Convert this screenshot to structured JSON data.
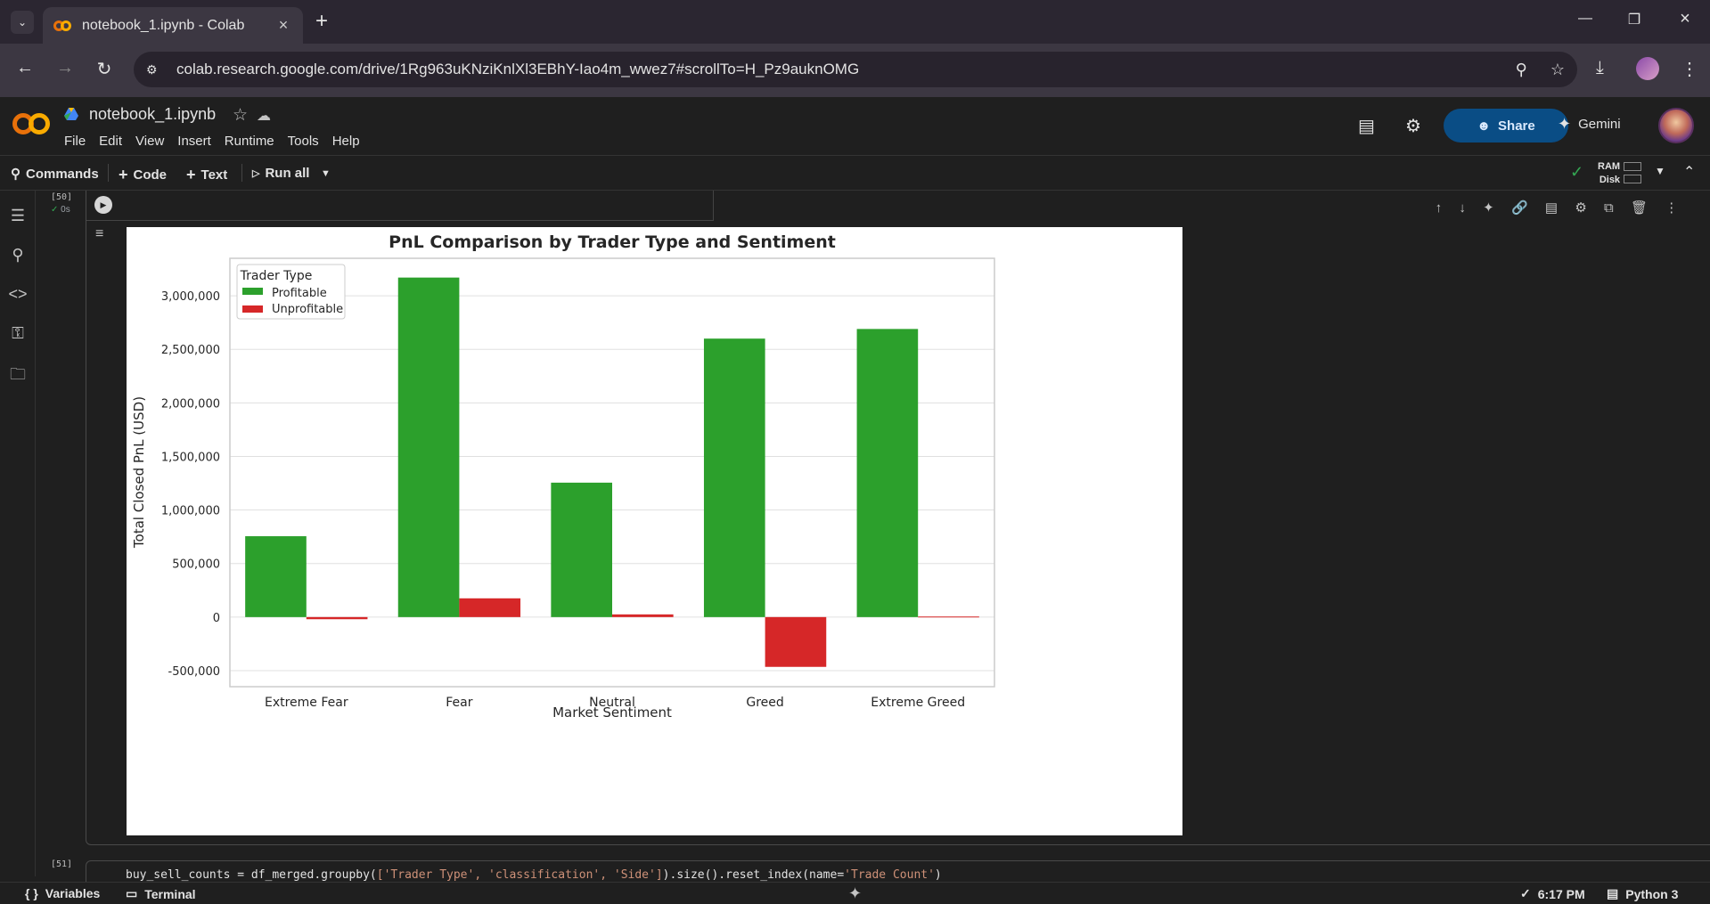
{
  "browser": {
    "tab_title": "notebook_1.ipynb - Colab",
    "url": "colab.research.google.com/drive/1Rg963uKNziKnlXl3EBhY-Iao4m_wwez7#scrollTo=H_Pz9auknOMG"
  },
  "colab": {
    "notebook_name": "notebook_1.ipynb",
    "menu": [
      "File",
      "Edit",
      "View",
      "Insert",
      "Runtime",
      "Tools",
      "Help"
    ],
    "share_label": "Share",
    "gemini_label": "Gemini"
  },
  "toolbar": {
    "commands_label": "Commands",
    "code_label": "Code",
    "text_label": "Text",
    "run_all_label": "Run all",
    "ram_label": "RAM",
    "disk_label": "Disk"
  },
  "cell": {
    "exec_count": "[50]",
    "exec_time": "0s",
    "next_exec_count": "[51]",
    "next_code_prefix": "buy_sell_counts = df_merged.groupby(",
    "next_code_str": "['Trader Type', 'classification', 'Side']",
    "next_code_mid": ").size().reset_index(name=",
    "next_code_str2": "'Trade Count'",
    "next_code_suffix": ")"
  },
  "chart_data": {
    "type": "bar",
    "title": "PnL Comparison by Trader Type and Sentiment",
    "xlabel": "Market Sentiment",
    "ylabel": "Total Closed PnL (USD)",
    "categories": [
      "Extreme Fear",
      "Fear",
      "Neutral",
      "Greed",
      "Extreme Greed"
    ],
    "series": [
      {
        "name": "Profitable",
        "color": "#2ca02c",
        "values": [
          755000,
          3170000,
          1255000,
          2600000,
          2690000
        ]
      },
      {
        "name": "Unprofitable",
        "color": "#d62728",
        "values": [
          -20000,
          175000,
          25000,
          -465000,
          5000
        ]
      }
    ],
    "legend_title": "Trader Type",
    "legend_position": "top-left",
    "ylim": [
      -650000,
      3350000
    ],
    "yticks": [
      -500000,
      0,
      500000,
      1000000,
      1500000,
      2000000,
      2500000,
      3000000
    ],
    "ytick_labels": [
      "-500,000",
      "0",
      "500,000",
      "1,000,000",
      "1,500,000",
      "2,000,000",
      "2,500,000",
      "3,000,000"
    ],
    "grid": true
  },
  "statusbar": {
    "variables_label": "Variables",
    "terminal_label": "Terminal",
    "time": "6:17 PM",
    "runtime": "Python 3"
  }
}
